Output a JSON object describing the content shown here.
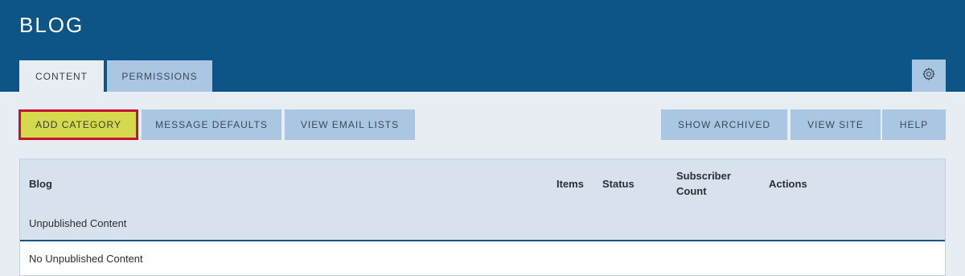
{
  "header": {
    "title": "BLOG",
    "tabs": [
      {
        "label": "CONTENT",
        "active": true
      },
      {
        "label": "PERMISSIONS",
        "active": false
      }
    ],
    "settings_icon": "gear-icon"
  },
  "toolbar": {
    "left": [
      {
        "label": "ADD CATEGORY"
      },
      {
        "label": "MESSAGE DEFAULTS"
      },
      {
        "label": "VIEW EMAIL LISTS"
      }
    ],
    "right": [
      {
        "label": "SHOW ARCHIVED"
      },
      {
        "label": "VIEW SITE"
      },
      {
        "label": "HELP"
      }
    ]
  },
  "table": {
    "columns": {
      "blog": "Blog",
      "items": "Items",
      "status": "Status",
      "subscriber_count": "Subscriber Count",
      "actions": "Actions"
    },
    "section_label": "Unpublished Content",
    "empty_message": "No Unpublished Content"
  },
  "colors": {
    "header_bg": "#0d5587",
    "page_bg": "#e8edf3",
    "button_bg": "#a9c6e3",
    "primary_button_bg": "#d4d94e",
    "highlight_border": "#c4142d"
  }
}
